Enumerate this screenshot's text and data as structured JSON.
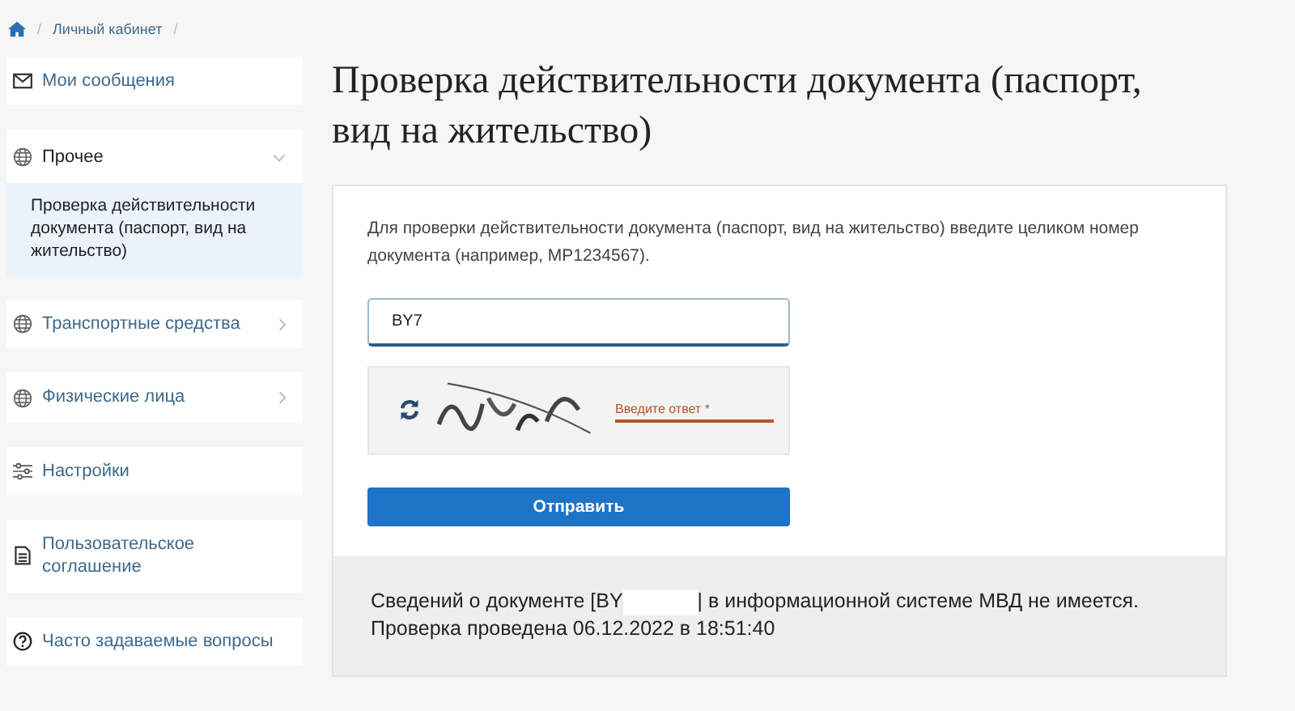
{
  "breadcrumbs": {
    "separator": "/",
    "items": [
      {
        "label": "Личный кабинет"
      }
    ]
  },
  "sidebar": {
    "items": [
      {
        "label": "Мои сообщения",
        "kind": "messages"
      },
      {
        "label": "Прочее",
        "kind": "group",
        "expanded": true,
        "children": [
          {
            "label": "Проверка действительности документа (паспорт, вид на жительство)",
            "selected": true
          }
        ]
      },
      {
        "label": "Транспортные средства",
        "kind": "group",
        "expanded": false
      },
      {
        "label": "Физические лица",
        "kind": "group",
        "expanded": false
      },
      {
        "label": "Настройки",
        "kind": "settings"
      },
      {
        "label": "Пользовательское соглашение",
        "kind": "document"
      },
      {
        "label": "Часто задаваемые вопросы",
        "kind": "help"
      }
    ]
  },
  "title": "Проверка действительности документа (паспорт, вид на жительство)",
  "form": {
    "instruction": "Для проверки действительности документа (паспорт, вид на жительство) введите целиком номер документа (например, MP1234567).",
    "document_field": {
      "value": "BY7"
    },
    "captcha": {
      "answer_placeholder": "Введите ответ *"
    },
    "submit": "Отправить"
  },
  "result": {
    "text_start": "Сведений о документе [BY",
    "text_end": "| в информационной системе МВД не имеется.",
    "checked_at": "Проверка проведена 06.12.2022 в 18:51:40"
  }
}
